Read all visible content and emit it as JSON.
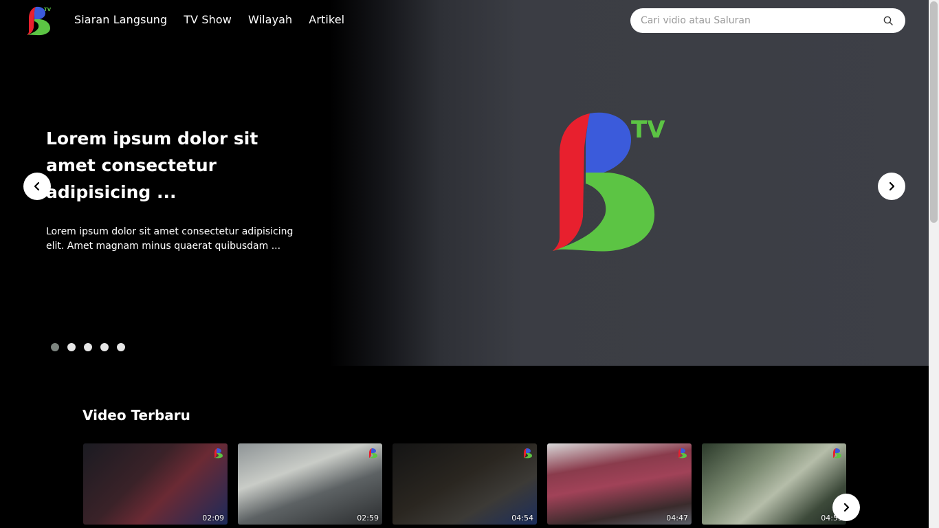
{
  "brand": {
    "logo_name": "BTV",
    "logo_text": "TV",
    "colors": {
      "red": "#e8202e",
      "blue": "#3b5bdb",
      "green": "#5cc444"
    }
  },
  "nav": {
    "items": [
      {
        "label": "Siaran Langsung"
      },
      {
        "label": "TV Show"
      },
      {
        "label": "Wilayah"
      },
      {
        "label": "Artikel"
      }
    ]
  },
  "search": {
    "placeholder": "Cari vidio atau Saluran",
    "value": ""
  },
  "hero": {
    "title": "Lorem ipsum dolor sit amet consectetur adipisicing ...",
    "description": "Lorem ipsum dolor sit amet consectetur adipisicing elit. Amet magnam minus quaerat quibusdam ...",
    "slides_count": 5,
    "active_slide": 1
  },
  "videos": {
    "title": "Video Terbaru",
    "items": [
      {
        "duration": "02:09"
      },
      {
        "duration": "02:59"
      },
      {
        "duration": "04:54"
      },
      {
        "duration": "04:47"
      },
      {
        "duration": "04:55"
      }
    ]
  },
  "icons": {
    "search": "search-icon",
    "prev": "chevron-left-icon",
    "next": "chevron-right-icon"
  }
}
